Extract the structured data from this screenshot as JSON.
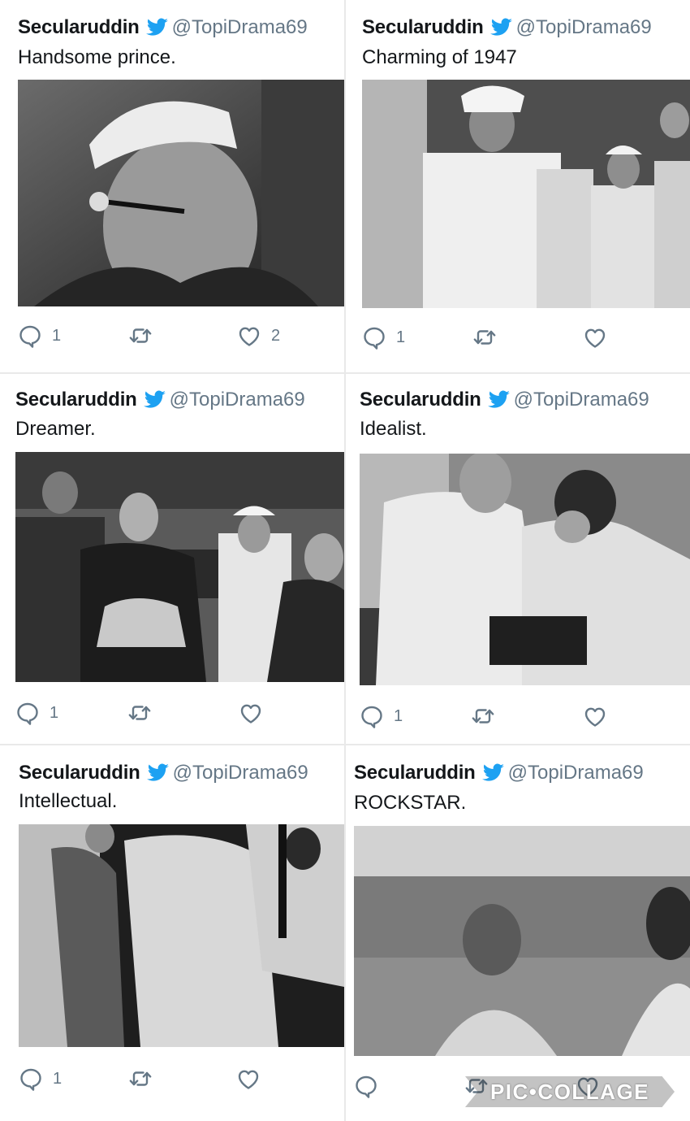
{
  "user": {
    "name": "Secularuddin",
    "handle": "@TopiDrama69"
  },
  "posts": [
    {
      "text": "Handsome prince.",
      "replies": "1",
      "likes": "2",
      "photo": "Black and white portrait of a man in a white cap smoking"
    },
    {
      "text": "Charming of 1947",
      "replies": "1",
      "likes": "",
      "photo": "Black and white photo of officers in white uniforms and a man in a white cap laughing"
    },
    {
      "text": "Dreamer.",
      "replies": "1",
      "likes": "",
      "photo": "Black and white photo of dancers in costume seated near a man in a white cap"
    },
    {
      "text": "Idealist.",
      "replies": "1",
      "likes": "",
      "photo": "Black and white photo of a woman lighting a man's cigarette"
    },
    {
      "text": "Intellectual.",
      "replies": "1",
      "likes": "",
      "photo": "Black and white photo of people in white clothes in a crowd"
    },
    {
      "text": "ROCKSTAR.",
      "replies": "",
      "likes": "",
      "photo": "Blurry black and white photo of a man in a pool"
    }
  ],
  "watermark": "PIC•COLLAGE",
  "icons": [
    "twitter-bird-icon",
    "reply-icon",
    "retweet-icon",
    "like-icon"
  ],
  "colors": {
    "name": "#14171a",
    "handle": "#657786",
    "bird": "#1da1f2",
    "background": "#e9e9e9"
  }
}
